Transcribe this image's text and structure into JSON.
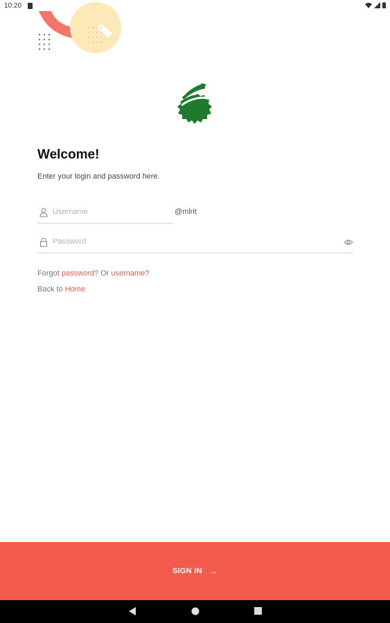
{
  "status_bar": {
    "time": "10:20"
  },
  "header": {
    "title": "Welcome!",
    "subtitle": "Enter your login and password here."
  },
  "form": {
    "username_placeholder": "Username",
    "domain_suffix": "@mlrit",
    "password_placeholder": "Password"
  },
  "links": {
    "forgot_prefix": "Forgot ",
    "password_link": "password",
    "or_text": "? Or ",
    "username_link": "username",
    "question_mark": "?",
    "back_prefix": "Back to ",
    "home_link": "Home"
  },
  "signin_button": {
    "label": "SIGN IN",
    "arrow": "→"
  },
  "colors": {
    "accent": "#f55b4d",
    "logo_green": "#1f7a2e",
    "deco_yellow": "#fde9b8",
    "deco_red": "#f4766b"
  },
  "icons": [
    "user-icon",
    "lock-icon",
    "eye-icon",
    "arrow-right-icon",
    "wifi-icon",
    "signal-icon",
    "battery-icon",
    "back-icon",
    "home-icon",
    "recents-icon"
  ]
}
